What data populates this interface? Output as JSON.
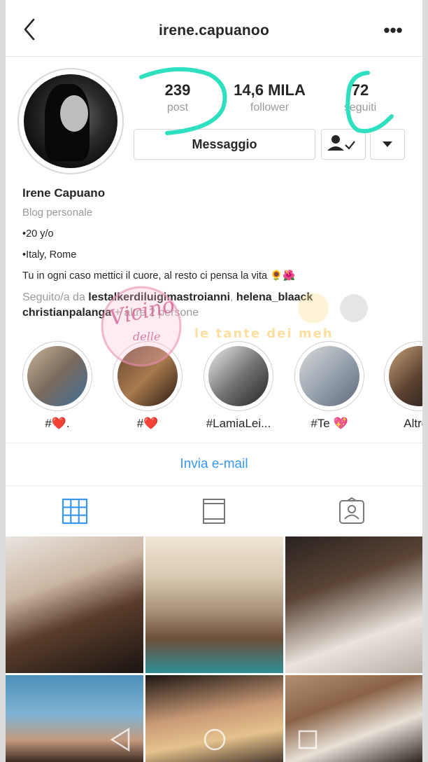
{
  "header": {
    "username": "irene.capuanoo",
    "more_label": "•••"
  },
  "stats": {
    "posts_value": "239",
    "posts_label": "post",
    "followers_value": "14,6 MILA",
    "followers_label": "follower",
    "following_value": "72",
    "following_label": "seguiti"
  },
  "actions": {
    "message_label": "Messaggio"
  },
  "bio": {
    "name": "Irene Capuano",
    "category": "Blog personale",
    "line1": "•20 y/o",
    "line2": "•Italy, Rome",
    "line3": "Tu in ogni caso mettici il cuore, al resto ci pensa la vita 🌻🌺",
    "followed_prefix": "Seguito/a da ",
    "followed_user1": "lestalkerdiluigimastroianni",
    "followed_sep": ", ",
    "followed_user2": "helena_blaack",
    "followed_user3": "christianpalanga",
    "followed_suffix": " + altre 2 persone"
  },
  "stories": [
    {
      "caption": "#❤️."
    },
    {
      "caption": "#❤️"
    },
    {
      "caption": "#LamiaLei..."
    },
    {
      "caption": "#Te 💖"
    },
    {
      "caption": "Altrov"
    }
  ],
  "email_label": "Invia e-mail",
  "watermark": {
    "text1": "Vicino",
    "text2": "delle",
    "text3": "le tante dei meh"
  },
  "colors": {
    "link": "#3897f0",
    "annotation": "#2ee0c0",
    "tab_active": "#3897f0"
  },
  "icons": {
    "back": "chevron-left-icon",
    "more": "more-icon",
    "follow": "person-check-icon",
    "dropdown": "caret-down-icon",
    "grid": "grid-icon",
    "feed": "feed-icon",
    "tagged": "tagged-icon"
  }
}
